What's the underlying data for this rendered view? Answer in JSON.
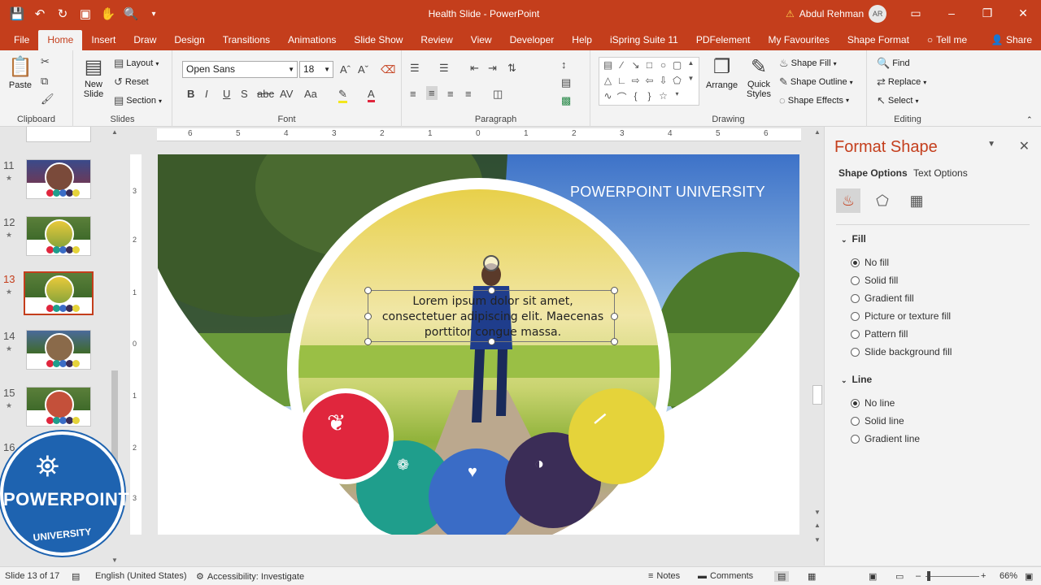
{
  "window": {
    "title": "Health Slide  -  PowerPoint",
    "user": "Abdul Rehman",
    "user_initials": "AR"
  },
  "qat": {
    "icons": [
      "save-icon",
      "undo-icon",
      "redo-icon",
      "start-from-beginning-icon",
      "touch-mode-icon",
      "print-preview-icon",
      "customize-icon"
    ]
  },
  "tabs": [
    "File",
    "Home",
    "Insert",
    "Draw",
    "Design",
    "Transitions",
    "Animations",
    "Slide Show",
    "Review",
    "View",
    "Developer",
    "Help",
    "iSpring Suite 11",
    "PDFelement",
    "My Favourites",
    "Shape Format"
  ],
  "tell_me": "Tell me",
  "share": "Share",
  "ribbon": {
    "clipboard": {
      "label": "Clipboard",
      "paste": "Paste"
    },
    "slides": {
      "label": "Slides",
      "new_slide": "New Slide",
      "layout": "Layout",
      "reset": "Reset",
      "section": "Section"
    },
    "font": {
      "label": "Font",
      "name": "Open Sans",
      "size": "18"
    },
    "paragraph": {
      "label": "Paragraph"
    },
    "drawing": {
      "label": "Drawing",
      "arrange": "Arrange",
      "quick_styles": "Quick Styles",
      "shape_fill": "Shape Fill",
      "shape_outline": "Shape Outline",
      "shape_effects": "Shape Effects"
    },
    "editing": {
      "label": "Editing",
      "find": "Find",
      "replace": "Replace",
      "select": "Select"
    }
  },
  "thumbnails": [
    {
      "num": "11",
      "star": "★"
    },
    {
      "num": "12",
      "star": "★"
    },
    {
      "num": "13",
      "star": "★"
    },
    {
      "num": "14",
      "star": "★"
    },
    {
      "num": "15",
      "star": "★"
    },
    {
      "num": "16",
      "star": ""
    }
  ],
  "logo": {
    "line1": "POWERPOINT",
    "line2": "UNIVERSITY"
  },
  "slide": {
    "watermark": "POWERPOINT UNIVERSITY",
    "body_text": "Lorem ipsum dolor sit amet, consectetuer adipiscing elit. Maecenas porttitor congue massa.",
    "icons": [
      "lungs-icon",
      "kidneys-icon",
      "heart-icon",
      "stomach-icon",
      "bone-icon"
    ],
    "colors": {
      "red": "#e0263d",
      "teal": "#1f9e8c",
      "blue": "#3a6cc6",
      "purple": "#3b2d57",
      "yellow": "#e5d33a"
    }
  },
  "ruler": {
    "h": [
      "6",
      "5",
      "4",
      "3",
      "2",
      "1",
      "0",
      "1",
      "2",
      "3",
      "4",
      "5",
      "6"
    ],
    "v": [
      "3",
      "2",
      "1",
      "0",
      "1",
      "2",
      "3"
    ]
  },
  "format_pane": {
    "title": "Format Shape",
    "tab_shape": "Shape Options",
    "tab_text": "Text Options",
    "fill_header": "Fill",
    "fill_options": [
      "No fill",
      "Solid fill",
      "Gradient fill",
      "Picture or texture fill",
      "Pattern fill",
      "Slide background fill"
    ],
    "line_header": "Line",
    "line_options": [
      "No line",
      "Solid line",
      "Gradient line"
    ]
  },
  "status": {
    "slide": "Slide 13 of 17",
    "language": "English (United States)",
    "accessibility": "Accessibility: Investigate",
    "notes": "Notes",
    "comments": "Comments",
    "zoom": "66%"
  }
}
